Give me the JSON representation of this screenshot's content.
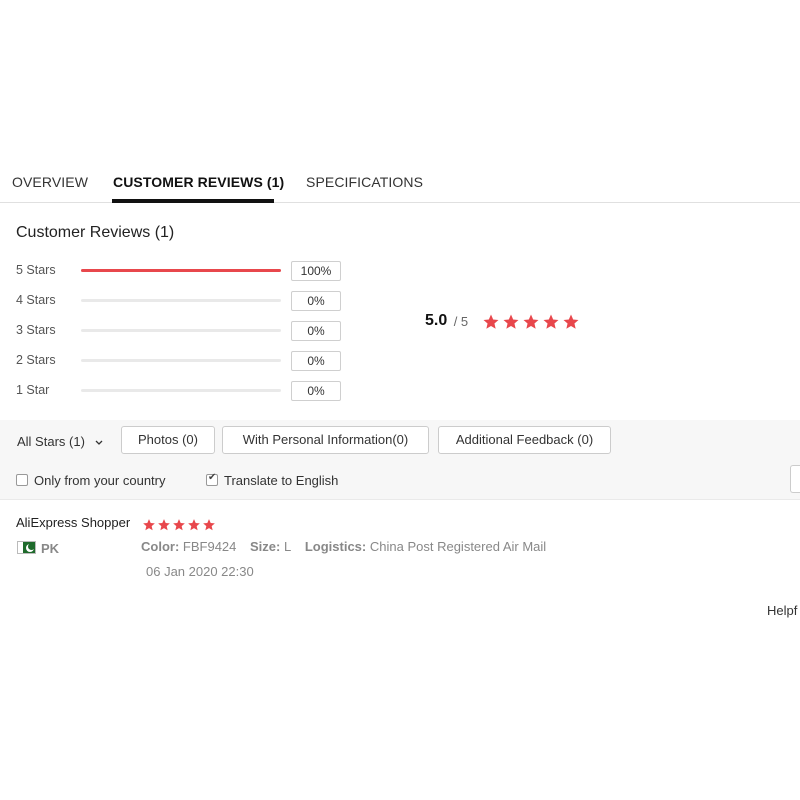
{
  "tabs": [
    {
      "label": "OVERVIEW"
    },
    {
      "label": "CUSTOMER REVIEWS (1)"
    },
    {
      "label": "SPECIFICATIONS"
    }
  ],
  "reviews_section": {
    "title": "Customer Reviews (1)",
    "histogram": [
      {
        "label": "5 Stars",
        "percent_text": "100%",
        "fill_fraction": 1.0
      },
      {
        "label": "4 Stars",
        "percent_text": "0%",
        "fill_fraction": 0.0
      },
      {
        "label": "3 Stars",
        "percent_text": "0%",
        "fill_fraction": 0.0
      },
      {
        "label": "2 Stars",
        "percent_text": "0%",
        "fill_fraction": 0.0
      },
      {
        "label": "1 Star",
        "percent_text": "0%",
        "fill_fraction": 0.0
      }
    ],
    "average": "5.0",
    "max_text": "/ 5",
    "average_stars": 5
  },
  "filters": {
    "all_stars_label": "All Stars (1)",
    "photos_button": "Photos (0)",
    "personal_info_button": "With Personal Information(0)",
    "additional_feedback_button": "Additional Feedback (0)",
    "only_country_label": "Only from your country",
    "only_country_checked": false,
    "translate_label": "Translate to English",
    "translate_checked": true
  },
  "review": {
    "reviewer": "AliExpress Shopper",
    "stars": 5,
    "country_code": "PK",
    "color_key": "Color:",
    "color_value": "FBF9424",
    "size_key": "Size:",
    "size_value": "L",
    "logistics_key": "Logistics:",
    "logistics_value": "China Post Registered Air Mail",
    "date": "06 Jan 2020 22:30",
    "helpful_text": "Helpf"
  },
  "colors": {
    "accent_red": "#e8474c",
    "tab_underline": "#111111"
  },
  "icons": {
    "star": "star-icon",
    "chevron": "chevron-down-icon",
    "flag": "flag-pk-icon"
  }
}
